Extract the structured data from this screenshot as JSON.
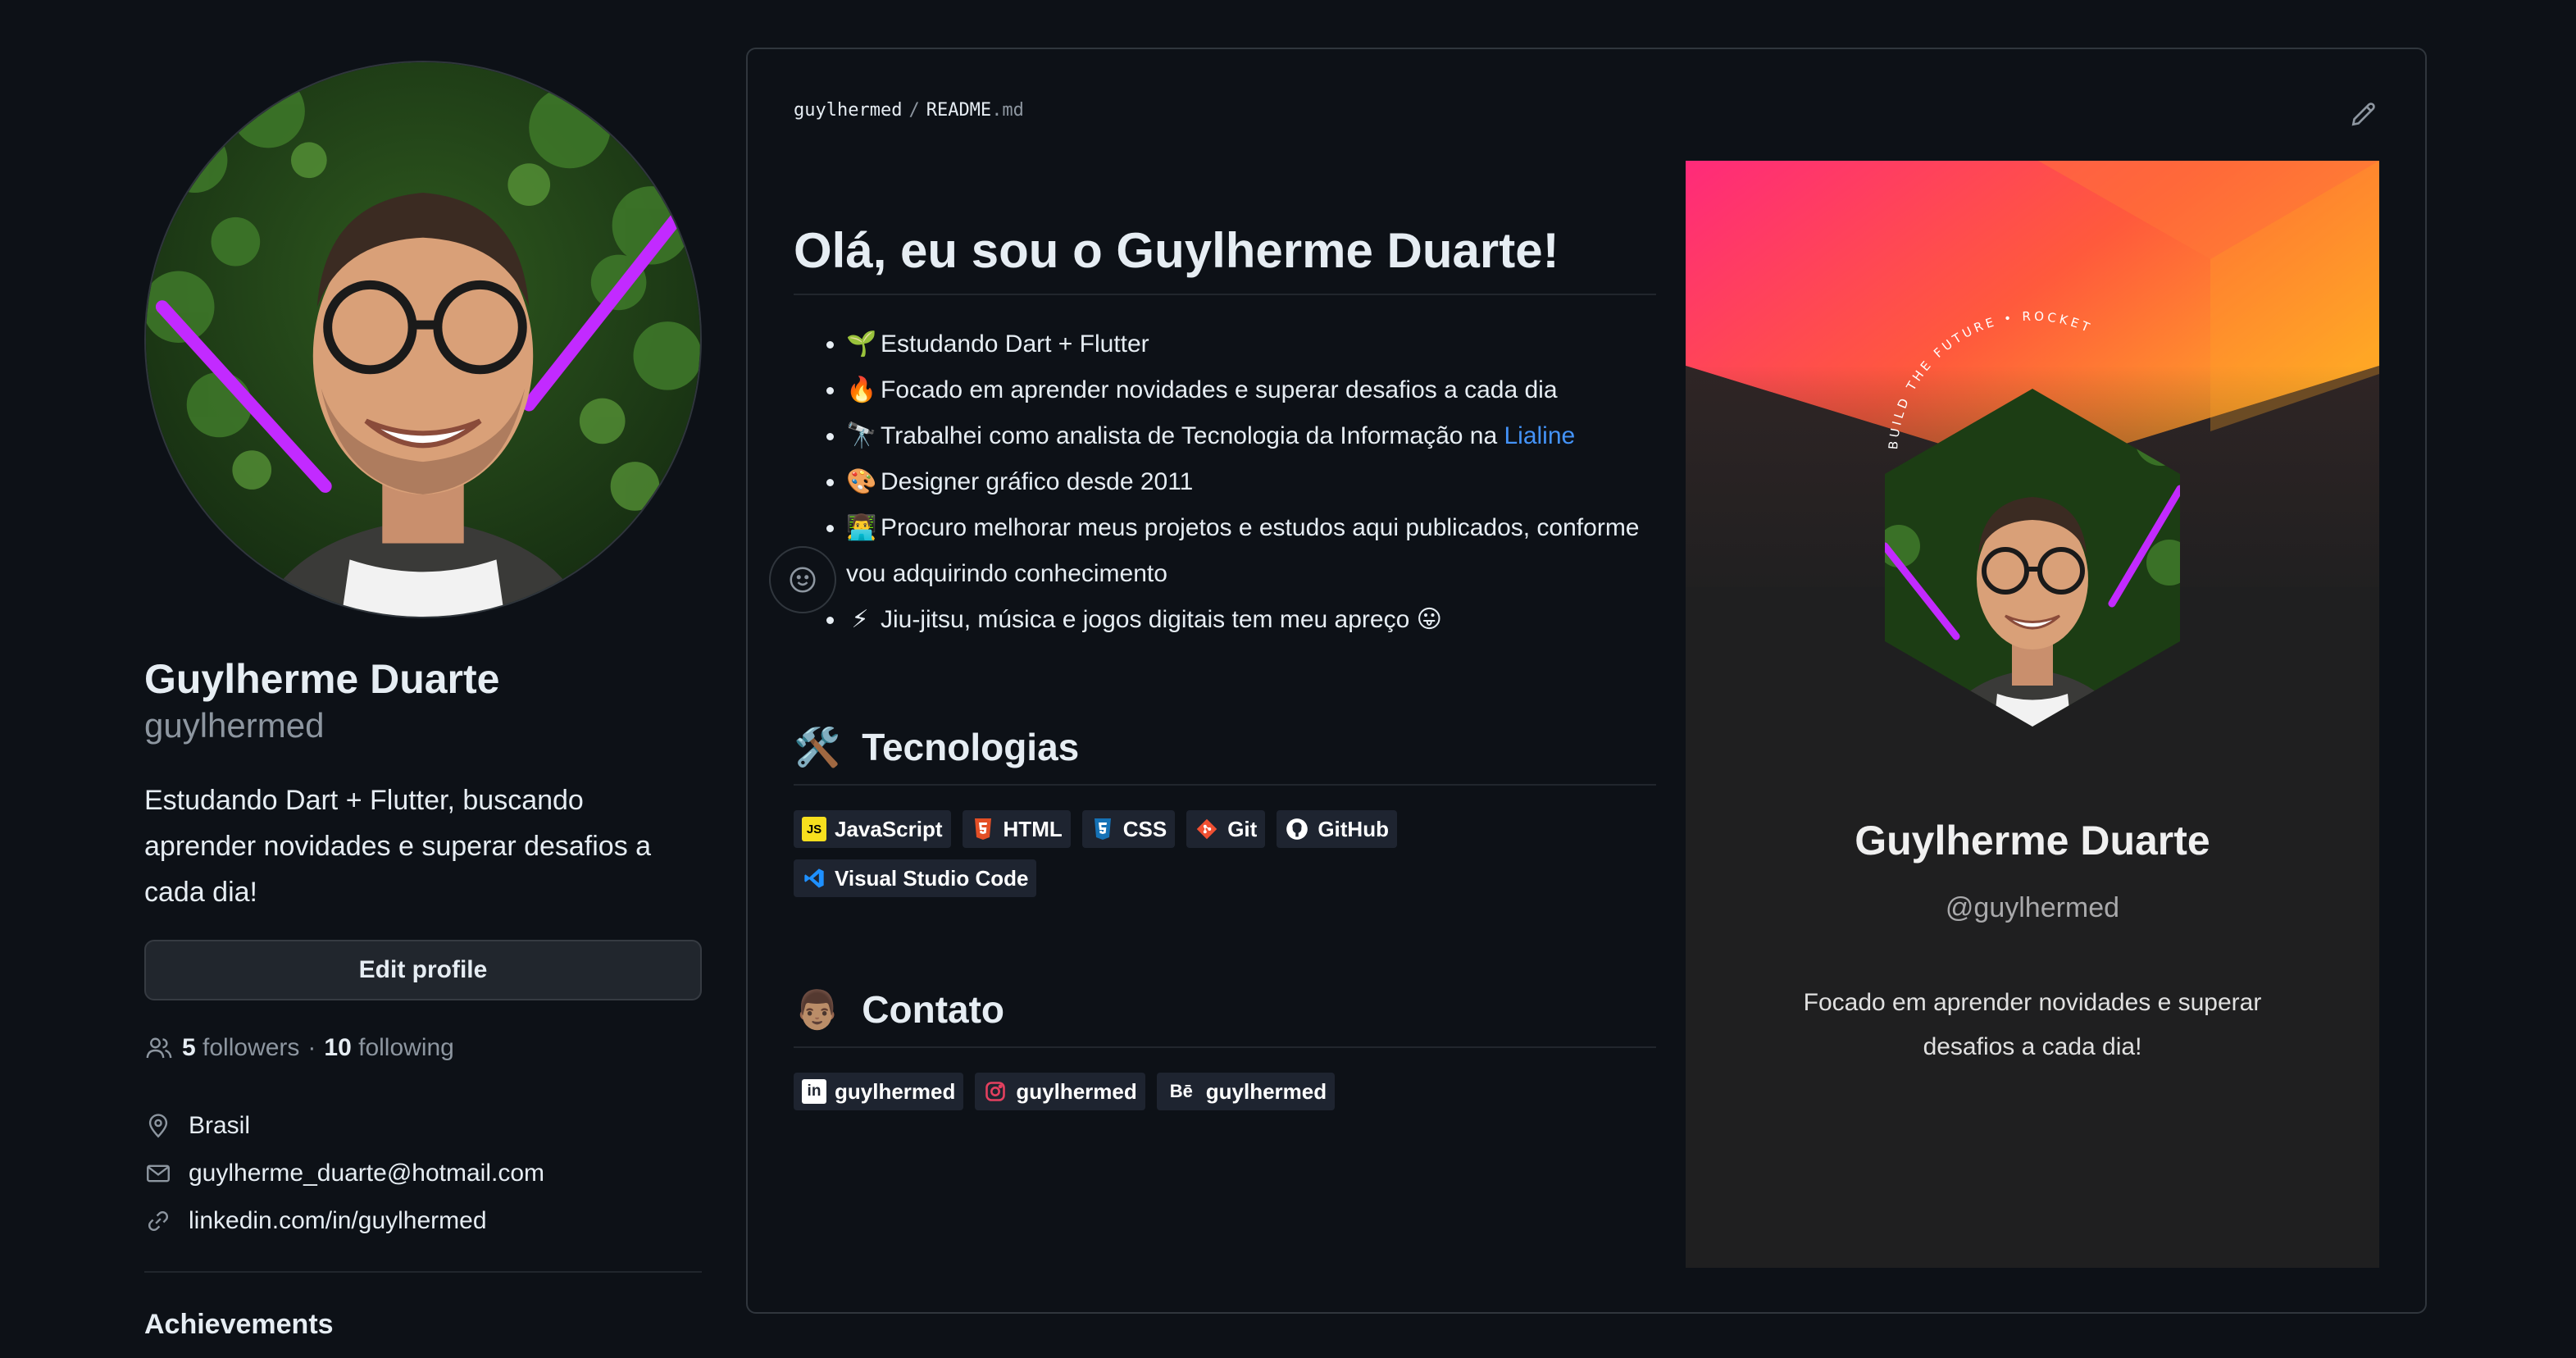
{
  "profile": {
    "name": "Guylherme Duarte",
    "login": "guylhermed",
    "bio": "Estudando Dart + Flutter, buscando aprender novidades e superar desafios a cada dia!",
    "edit_label": "Edit profile",
    "followers_count": "5",
    "followers_label": "followers",
    "separator": "·",
    "following_count": "10",
    "following_label": "following",
    "location": "Brasil",
    "email": "guylherme_duarte@hotmail.com",
    "website": "linkedin.com/in/guylhermed",
    "achievements_label": "Achievements"
  },
  "readme": {
    "owner": "guylhermed",
    "separator": "/",
    "filename": "README",
    "ext": ".md",
    "heading": "Olá, eu sou o Guylherme Duarte!",
    "items": [
      {
        "emoji": "🌱",
        "text": "Estudando Dart + Flutter"
      },
      {
        "emoji": "🔥",
        "text": "Focado em aprender novidades e superar desafios a cada dia"
      },
      {
        "emoji": "🔭",
        "text": "Trabalhei como analista de Tecnologia da Informação na ",
        "link": "Lialine"
      },
      {
        "emoji": "🎨",
        "text": "Designer gráfico desde 2011"
      },
      {
        "emoji": "👨‍💻",
        "text": "Procuro melhorar meus projetos e estudos aqui publicados, conforme vou adquirindo conhecimento"
      },
      {
        "emoji": "⚡",
        "text": "Jiu-jitsu, música e jogos digitais tem meu apreço",
        "trail": "😛"
      }
    ],
    "tech_heading": "Tecnologias",
    "tech_emoji": "🛠️",
    "tech_badges": [
      "JavaScript",
      "HTML",
      "CSS",
      "Git",
      "GitHub",
      "Visual Studio Code"
    ],
    "contact_heading": "Contato",
    "contact_emoji": "👨🏽",
    "contact_badges": [
      "guylhermed",
      "guylhermed",
      "guylhermed"
    ]
  },
  "card": {
    "name": "Guylherme Duarte",
    "handle": "@guylhermed",
    "description": "Focado em aprender novidades e superar desafios a cada dia!",
    "ring_text": "BUILD THE FUTURE • ROCKET",
    "colors": {
      "gradient_start": "#ff2a6d",
      "gradient_end": "#ffa726",
      "card_bg": "#1f1f20"
    }
  },
  "colors": {
    "page_bg": "#0d1117",
    "link": "#4493f8",
    "muted": "#8d96a0",
    "border": "#30363d"
  }
}
